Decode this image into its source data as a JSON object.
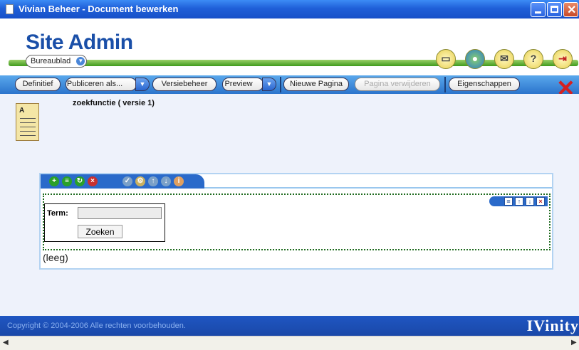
{
  "window": {
    "title": "Vivian Beheer - Document bewerken"
  },
  "header": {
    "brand": "Site Admin",
    "workspace_select": "Bureaublad",
    "icons": [
      "pages-icon",
      "globe-icon",
      "mail-icon",
      "help-icon",
      "logout-icon"
    ]
  },
  "toolbar": {
    "definitief": "Definitief",
    "publiceren": "Publiceren als...",
    "versiebeheer": "Versiebeheer",
    "preview": "Preview",
    "nieuwe_pagina": "Nieuwe Pagina",
    "pagina_verwijderen": "Pagina verwijderen",
    "eigenschappen": "Eigenschappen"
  },
  "document": {
    "title": "zoekfunctie ( versie 1)",
    "icon_tag": "A"
  },
  "search": {
    "term_label": "Term:",
    "term_value": "",
    "button": "Zoeken"
  },
  "empty_label": "(leeg)",
  "footer": {
    "copyright": "Copyright © 2004-2006 Alle rechten voorbehouden.",
    "logo": "IVinity"
  },
  "colors": {
    "accent": "#2a6aca",
    "brand": "#1a4fa8",
    "green": "#3f9a1c"
  }
}
